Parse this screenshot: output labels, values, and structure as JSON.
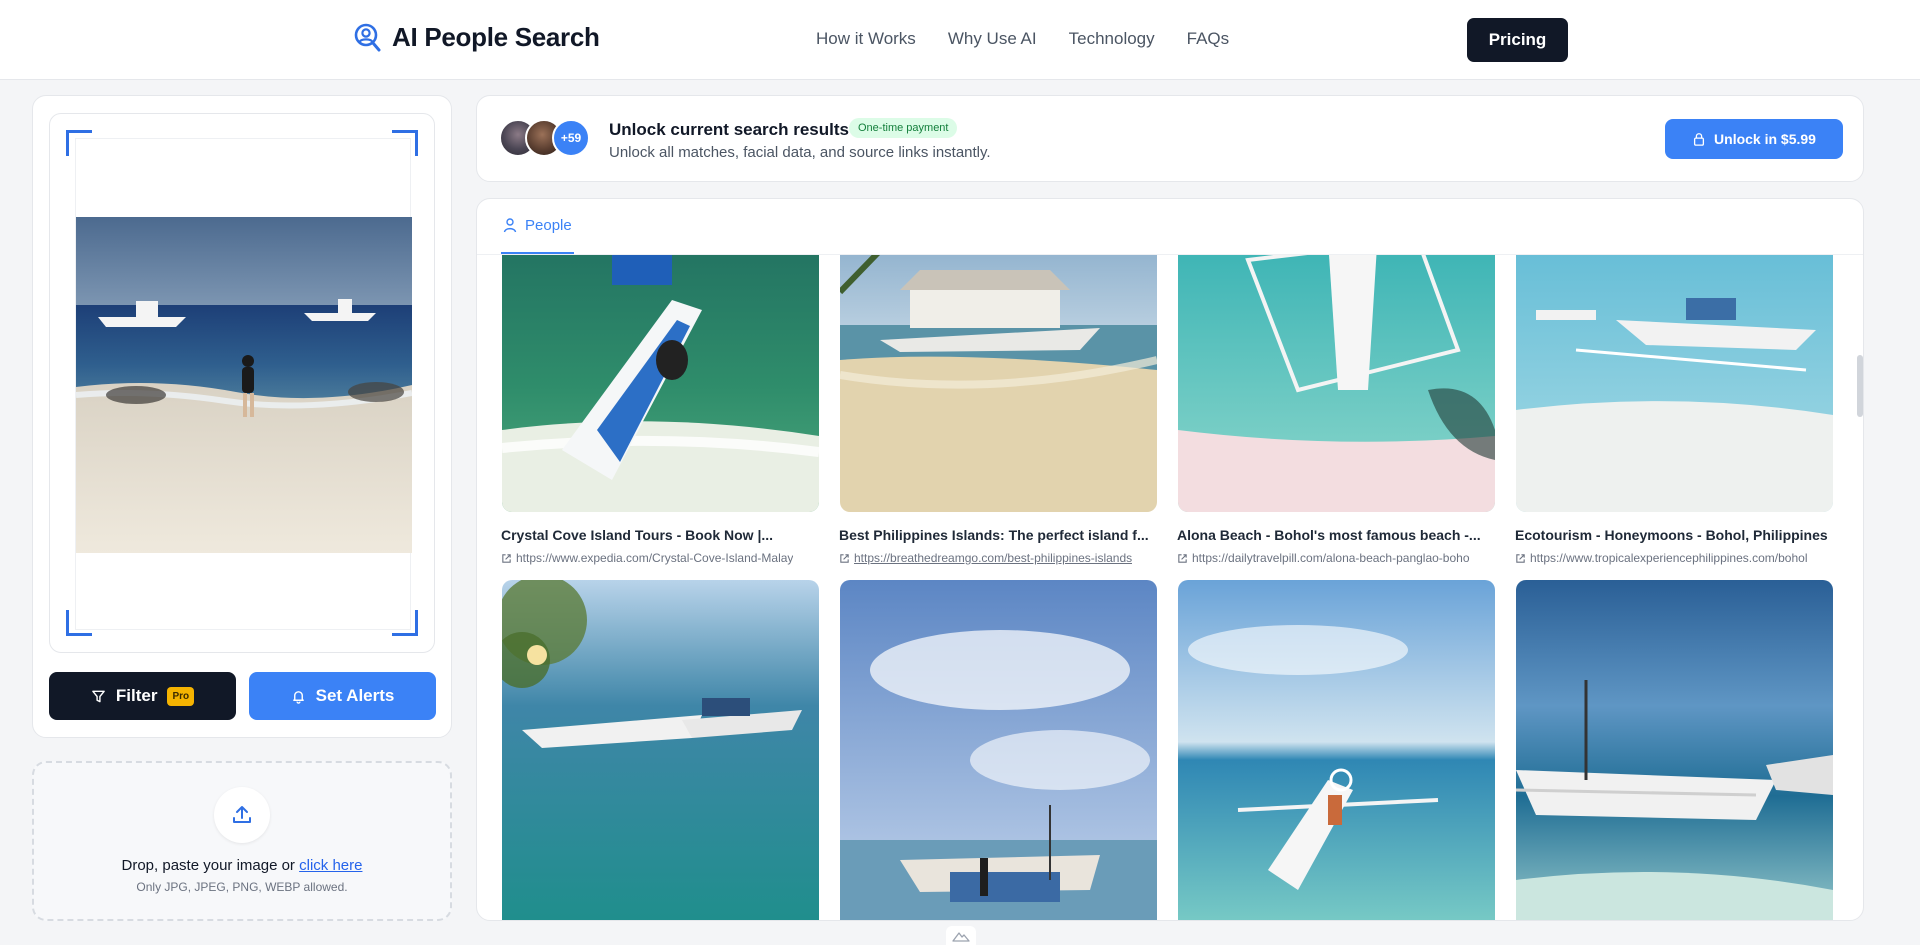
{
  "header": {
    "brand": "AI People Search",
    "nav": [
      "How it Works",
      "Why Use AI",
      "Technology",
      "FAQs"
    ],
    "pricing_label": "Pricing"
  },
  "left": {
    "filter_label": "Filter",
    "pro_badge": "Pro",
    "alerts_label": "Set Alerts",
    "upload_text": "Drop, paste your image or ",
    "upload_link": "click here",
    "upload_sub": "Only JPG, JPEG, PNG, WEBP allowed."
  },
  "unlock": {
    "avatar_count": "+59",
    "title": "Unlock current search results",
    "badge": "One-time payment",
    "subtitle": "Unlock all matches, facial data, and source links instantly.",
    "button": "Unlock in $5.99"
  },
  "tabs": {
    "people": "People"
  },
  "results": [
    {
      "title": "Crystal Cove Island Tours - Book Now |...",
      "url": "https://www.expedia.com/Crystal-Cove-Island-Malay"
    },
    {
      "title": "Best Philippines Islands: The perfect island f...",
      "url": "https://breathedreamgo.com/best-philippines-islands"
    },
    {
      "title": "Alona Beach - Bohol's most famous beach -...",
      "url": "https://dailytravelpill.com/alona-beach-panglao-boho"
    },
    {
      "title": "Ecotourism - Honeymoons - Bohol, Philippines",
      "url": "https://www.tropicalexperiencephilippines.com/bohol"
    }
  ],
  "colors": {
    "accent": "#3b82f6",
    "dark": "#111827",
    "pro": "#f5b301",
    "badge_bg": "#dcfce7",
    "badge_text": "#15803d"
  }
}
